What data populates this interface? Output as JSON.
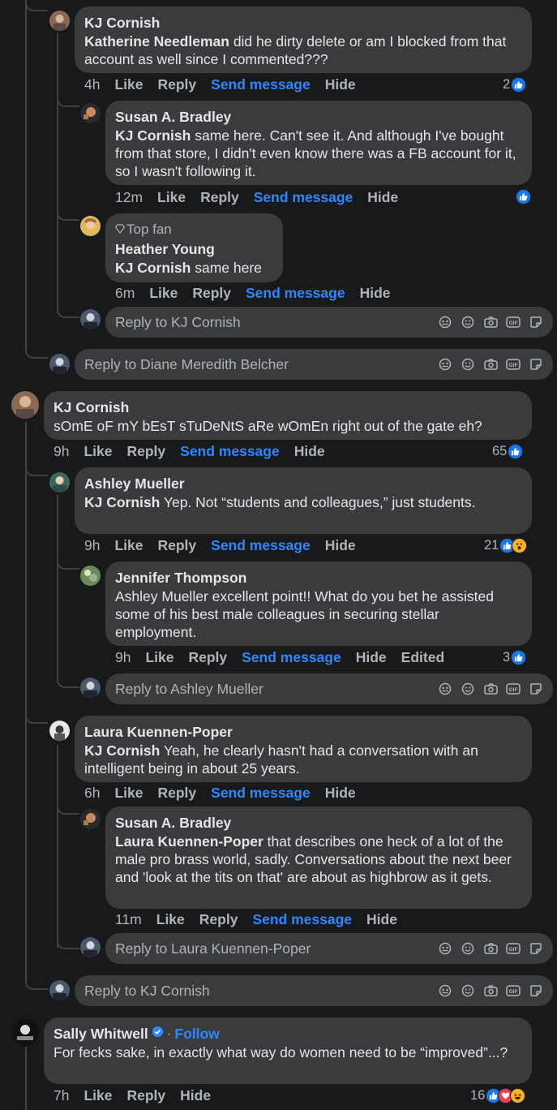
{
  "labels": {
    "like": "Like",
    "reply": "Reply",
    "send": "Send message",
    "hide": "Hide",
    "edited": "Edited",
    "follow": "Follow",
    "dot": "·",
    "top_fan": "Top fan"
  },
  "comments": [
    {
      "author": "KJ Cornish",
      "mention": "Katherine Needleman",
      "text": " did he dirty delete or am I blocked from that account as well since I commented???",
      "time": "4h",
      "reactions": "2"
    },
    {
      "author": "Susan A. Bradley",
      "mention": "KJ Cornish",
      "text": " same here. Can't see it. And although I've bought from that store, I didn't even know there was a FB account for it, so I wasn't following it.",
      "time": "12m",
      "reactions": ""
    },
    {
      "author": "Heather Young",
      "mention": "KJ Cornish",
      "text": " same here",
      "time": "6m"
    },
    {
      "author": "KJ Cornish",
      "mention": "",
      "text": "sOmE oF mY bEsT sTuDeNtS aRe wOmEn right out of the gate eh?",
      "time": "9h",
      "reactions": "65"
    },
    {
      "author": "Ashley Mueller",
      "mention": "KJ Cornish",
      "text": " Yep. Not “students and colleagues,” just students.",
      "time": "9h",
      "reactions": "21"
    },
    {
      "author": "Jennifer Thompson",
      "mention": "",
      "text": "Ashley Mueller excellent point!! What do you bet he assisted some of his best male colleagues in securing stellar employment.",
      "time": "9h",
      "reactions": "3"
    },
    {
      "author": "Laura Kuennen-Poper",
      "mention": "KJ Cornish",
      "text": " Yeah, he clearly hasn't had a conversation with an intelligent being in about 25 years.",
      "time": "6h"
    },
    {
      "author": "Susan A. Bradley",
      "mention": "Laura Kuennen-Poper",
      "text": " that describes one heck of a lot of the male pro brass world, sadly. Conversations about the next beer and 'look at the tits on that' are about as highbrow as it gets.",
      "time": "11m"
    },
    {
      "author": "Sally Whitwell",
      "mention": "",
      "text": "For fecks sake, in exactly what way do women need to be “improved”...?",
      "time": "7h",
      "reactions": "16"
    }
  ],
  "reply_boxes": [
    "Reply to KJ Cornish",
    "Reply to Diane Meredith Belcher",
    "Reply to Ashley Mueller",
    "Reply to Laura Kuennen-Poper",
    "Reply to KJ Cornish"
  ],
  "colors": {
    "background": "#18191a",
    "bubble": "#3a3b3c",
    "link": "#2d88ff",
    "secondary": "#b0b3b8",
    "text": "#e4e6eb"
  },
  "icons": [
    "avatar-icon",
    "sticker-icon",
    "emoji-icon",
    "camera-icon",
    "gif-icon",
    "sticker-square-icon",
    "like-reaction-icon",
    "love-reaction-icon",
    "haha-reaction-icon",
    "verified-badge-icon",
    "diamond-icon"
  ]
}
